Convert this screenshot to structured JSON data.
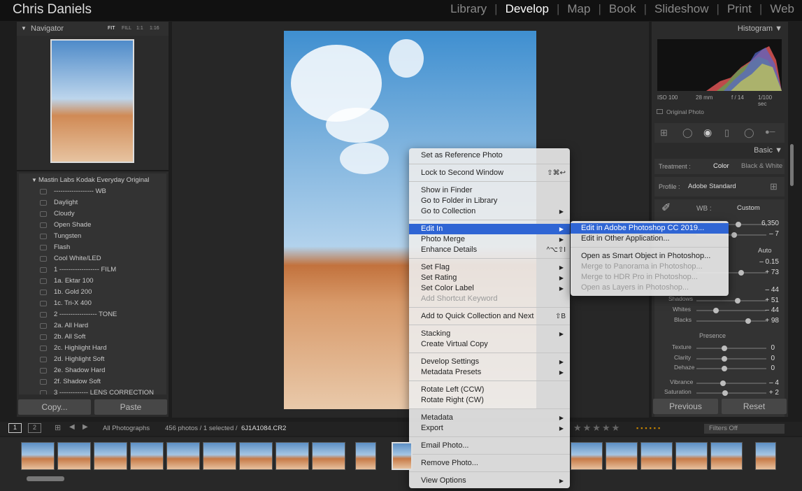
{
  "header": {
    "user": "Chris Daniels",
    "modules": [
      "Library",
      "Develop",
      "Map",
      "Book",
      "Slideshow",
      "Print",
      "Web"
    ],
    "active": "Develop"
  },
  "navigator": {
    "title": "Navigator",
    "zooms": [
      "FIT",
      "FILL",
      "1:1",
      "1:16"
    ]
  },
  "presets": {
    "group": "Mastin Labs Kodak Everyday Original",
    "items": [
      "------------------ WB",
      "Daylight",
      "Cloudy",
      "Open Shade",
      "Tungsten",
      "Flash",
      "Cool White/LED",
      "1 ------------------ FILM",
      "1a. Ektar 100",
      "1b. Gold 200",
      "1c. Tri-X 400",
      "2 ----------------- TONE",
      "2a. All Hard",
      "2b. All Soft",
      "2c. Highlight Hard",
      "2d. Highlight Soft",
      "2e. Shadow Hard",
      "2f. Shadow Soft",
      "3 ------------- LENS CORRECTION"
    ]
  },
  "left_buttons": {
    "copy": "Copy...",
    "paste": "Paste"
  },
  "histogram": {
    "title": "Histogram",
    "iso": "ISO 100",
    "focal": "28 mm",
    "aperture": "f / 14",
    "shutter": "1/100 sec",
    "original": "Original Photo"
  },
  "basic": {
    "title": "Basic",
    "treatment_label": "Treatment :",
    "color": "Color",
    "bw": "Black & White",
    "profile_label": "Profile :",
    "profile": "Adobe Standard",
    "wb_label": "WB :",
    "wb_value": "Custom",
    "temp": "6,350",
    "tint": "– 7",
    "auto": "Auto",
    "exposure": "– 0.15",
    "contrast": "+ 73",
    "highlights": "– 44",
    "shadows_label": "Shadows",
    "shadows": "+ 51",
    "whites_label": "Whites",
    "whites": "– 44",
    "blacks_label": "Blacks",
    "blacks": "+ 98",
    "presence": "Presence",
    "texture_label": "Texture",
    "texture": "0",
    "clarity_label": "Clarity",
    "clarity": "0",
    "dehaze_label": "Dehaze",
    "dehaze": "0",
    "vibrance_label": "Vibrance",
    "vibrance": "– 4",
    "saturation_label": "Saturation",
    "saturation": "+ 2"
  },
  "right_buttons": {
    "previous": "Previous",
    "reset": "Reset"
  },
  "filmstrip": {
    "source": "All Photographs",
    "count": "456 photos / 1 selected /",
    "file": "6J1A1084.CR2",
    "filter": "Filters Off"
  },
  "context_menu": [
    {
      "label": "Set as Reference Photo"
    },
    {
      "label": "Lock to Second Window",
      "shortcut": "⇧⌘↩"
    },
    {
      "label": "Show in Finder"
    },
    {
      "label": "Go to Folder in Library"
    },
    {
      "label": "Go to Collection",
      "submenu": "▶"
    },
    {
      "label": "Edit In",
      "submenu": "▶"
    },
    {
      "label": "Photo Merge",
      "submenu": "▶"
    },
    {
      "label": "Enhance Details",
      "shortcut": "^⌥⇧I"
    },
    {
      "label": "Set Flag",
      "submenu": "▶"
    },
    {
      "label": "Set Rating",
      "submenu": "▶"
    },
    {
      "label": "Set Color Label",
      "submenu": "▶"
    },
    {
      "label": "Add Shortcut Keyword"
    },
    {
      "label": "Add to Quick Collection and Next",
      "shortcut": "⇧B"
    },
    {
      "label": "Stacking",
      "submenu": "▶"
    },
    {
      "label": "Create Virtual Copy"
    },
    {
      "label": "Develop Settings",
      "submenu": "▶"
    },
    {
      "label": "Metadata Presets",
      "submenu": "▶"
    },
    {
      "label": "Rotate Left (CCW)"
    },
    {
      "label": "Rotate Right (CW)"
    },
    {
      "label": "Metadata",
      "submenu": "▶"
    },
    {
      "label": "Export",
      "submenu": "▶"
    },
    {
      "label": "Email Photo..."
    },
    {
      "label": "Remove Photo..."
    },
    {
      "label": "View Options",
      "submenu": "▶"
    }
  ],
  "submenu": [
    "Edit in Adobe Photoshop CC 2019...",
    "Edit in Other Application...",
    "Open as Smart Object in Photoshop...",
    "Merge to Panorama in Photoshop...",
    "Merge to HDR Pro in Photoshop...",
    "Open as Layers in Photoshop..."
  ],
  "colors": {
    "highlight": "#2f65d4",
    "panel": "#2b2b2b",
    "background": "#1d1d1d"
  }
}
